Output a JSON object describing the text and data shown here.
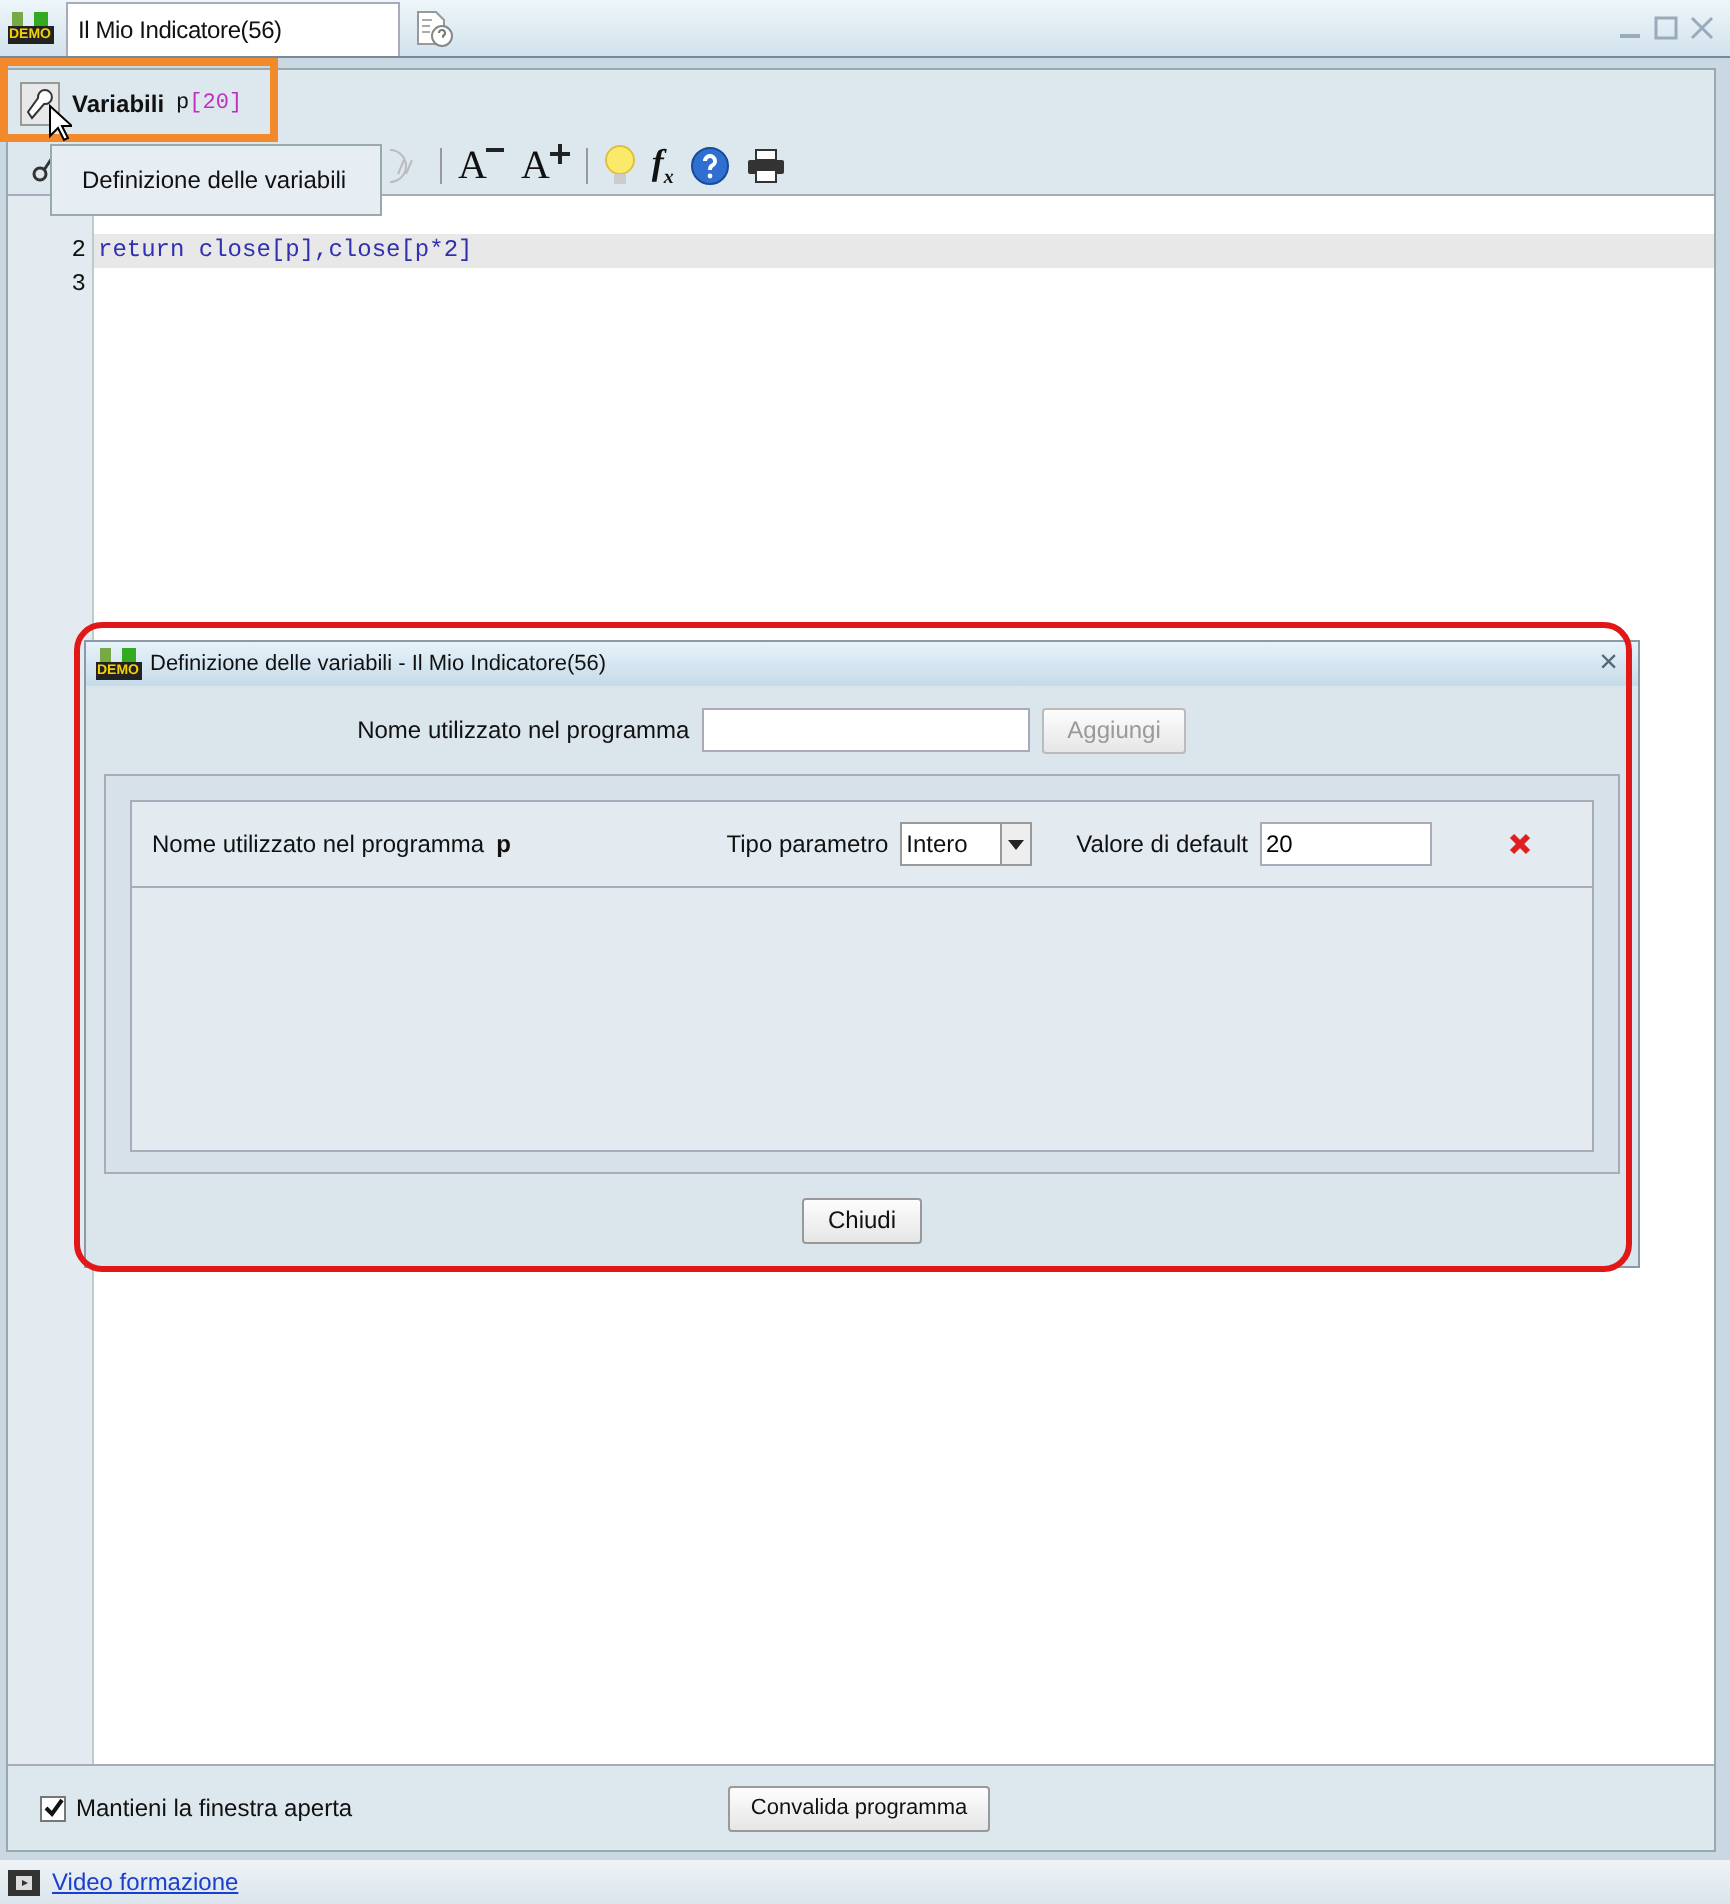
{
  "window": {
    "logo_text": "DEMO",
    "tab_title": "Il Mio Indicatore(56)"
  },
  "variables_bar": {
    "label": "Variabili",
    "name": "p",
    "suffix": "[20]"
  },
  "menu": {
    "items": [
      "Definizione delle variabili"
    ]
  },
  "toolbar": {
    "font_smaller": "A",
    "font_larger": "A",
    "function": "f",
    "function_sub": "x"
  },
  "editor": {
    "lines": [
      {
        "number": "2",
        "text": "return close[p],close[p*2]",
        "highlighted": true
      },
      {
        "number": "3",
        "highlighted": false
      }
    ]
  },
  "dialog": {
    "logo_text": "DEMO",
    "title": "Definizione delle variabili - Il Mio Indicatore(56)",
    "close": "×",
    "add_label": "Nome utilizzato nel programma",
    "add_button": {
      "label": "Aggiungi",
      "disabled": true
    },
    "variables": [
      {
        "name_label": "Nome utilizzato nel programma",
        "name": "p",
        "type_label": "Tipo parametro",
        "type": "Intero",
        "default_label": "Valore di default",
        "default": "20"
      }
    ],
    "close_button": "Chiudi"
  },
  "footer": {
    "keep_open": {
      "label": "Mantieni la finestra aperta",
      "checked": true
    },
    "validate_button": "Convalida programma"
  },
  "status_bar": {
    "link": "Video formazione"
  }
}
